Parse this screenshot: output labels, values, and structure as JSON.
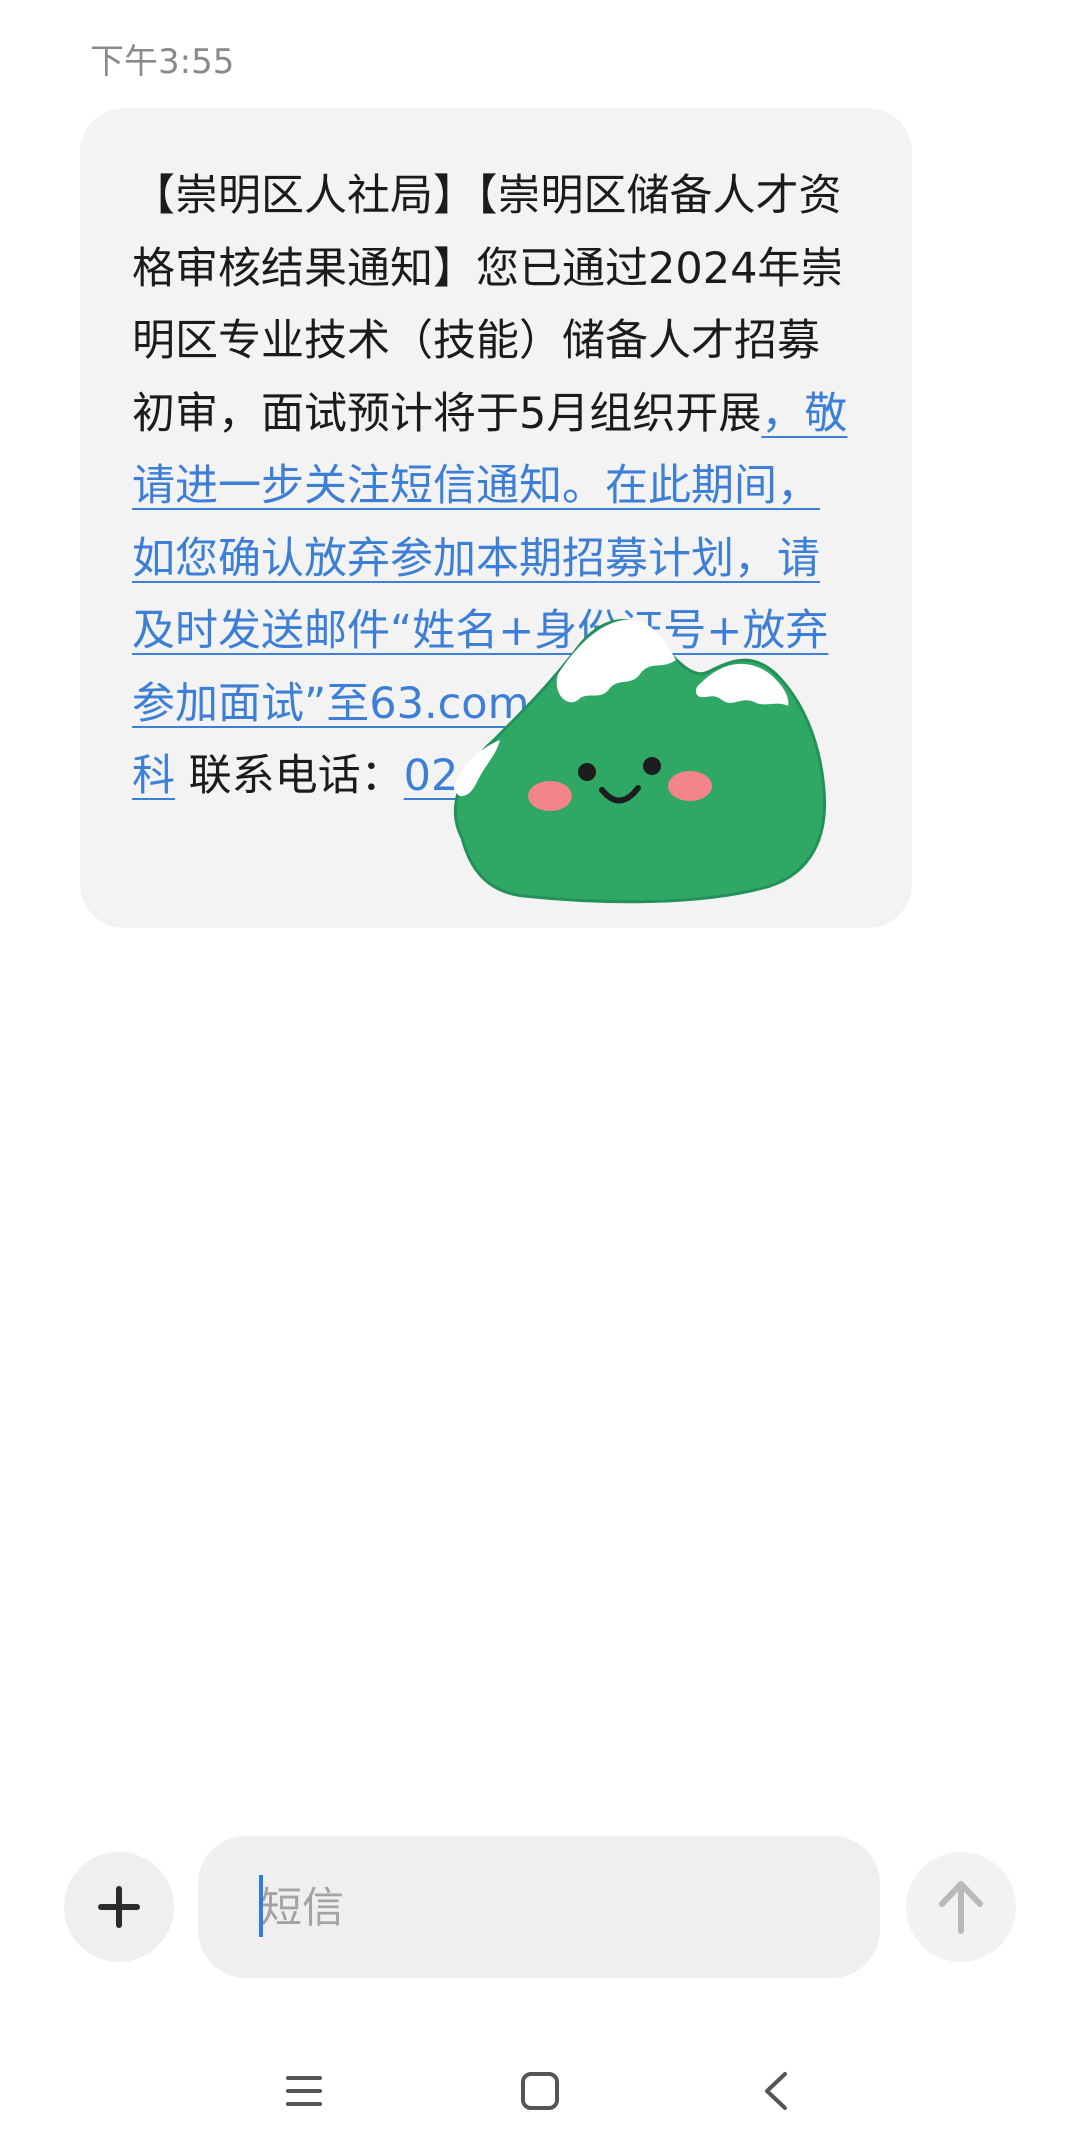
{
  "timestamp": "下午3:55",
  "message": {
    "plain_intro": "【崇明区人社局】【崇明区储备人才资格审核结果通知】您已通过2024年崇明区专业技术（技能）储备人才招募初审，面试预计将于5月组织开展",
    "link_text": "，敬请进一步关注短信通知。在此期间，如您确认放弃参加本期招募计划，请及时发送邮件“姓名+身份证号+放弃参加面试”至",
    "link_text_tail": "63.com。——崇明",
    "link_text_end": "科",
    "contact_label": " 联系电话：",
    "phone_visible": "02"
  },
  "sticker": {
    "icon": "smiling-mountain-sticker",
    "colors": {
      "body": "#2fa865",
      "snow": "#ffffff",
      "cheek": "#f2848a"
    }
  },
  "composer": {
    "add_icon": "plus-icon",
    "placeholder": "短信",
    "value": "",
    "send_icon": "arrow-up-icon"
  },
  "navbar": {
    "menu_icon": "menu-icon",
    "home_icon": "home-square-icon",
    "back_icon": "back-chevron-icon"
  },
  "colors": {
    "link": "#3d7fd6",
    "bubble_bg": "#f3f3f3",
    "caret": "#2f7de1"
  }
}
